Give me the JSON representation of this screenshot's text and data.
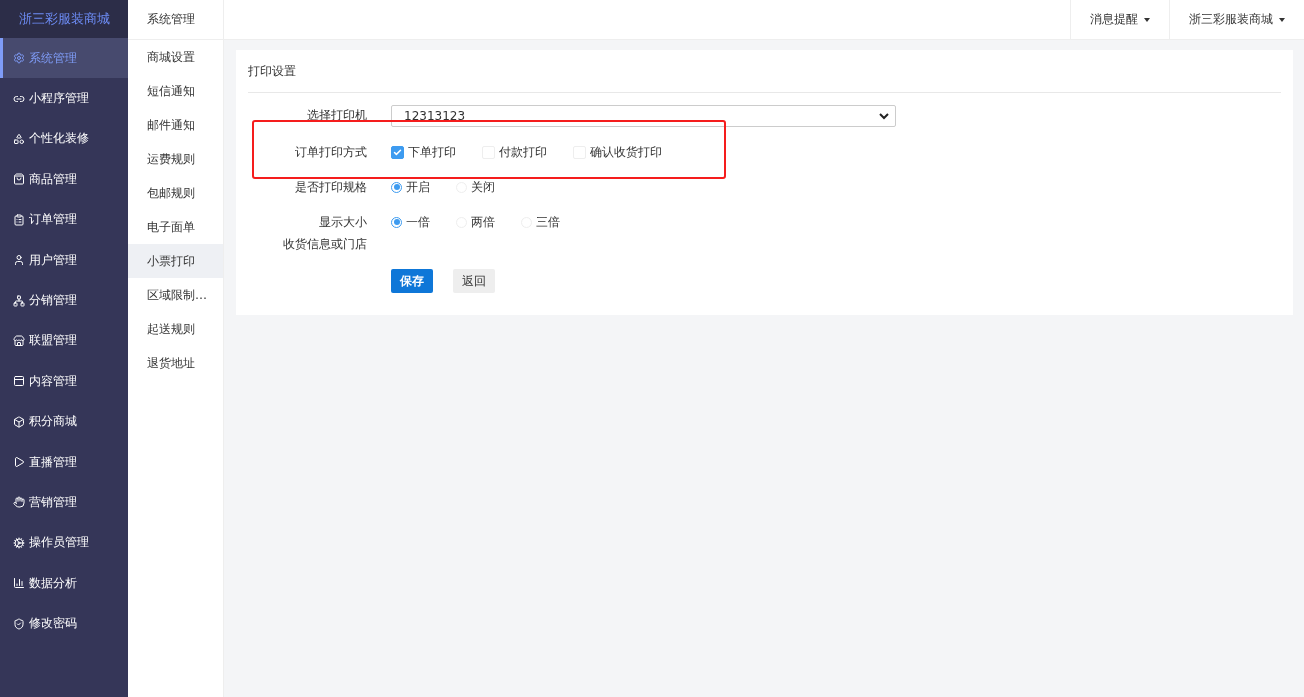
{
  "brand": "浙三彩服装商城",
  "sidebar": {
    "items": [
      {
        "label": "系统管理",
        "selected": true
      },
      {
        "label": "小程序管理",
        "selected": false
      },
      {
        "label": "个性化装修",
        "selected": false
      },
      {
        "label": "商品管理",
        "selected": false
      },
      {
        "label": "订单管理",
        "selected": false
      },
      {
        "label": "用户管理",
        "selected": false
      },
      {
        "label": "分销管理",
        "selected": false
      },
      {
        "label": "联盟管理",
        "selected": false
      },
      {
        "label": "内容管理",
        "selected": false
      },
      {
        "label": "积分商城",
        "selected": false
      },
      {
        "label": "直播管理",
        "selected": false
      },
      {
        "label": "营销管理",
        "selected": false
      },
      {
        "label": "操作员管理",
        "selected": false
      },
      {
        "label": "数据分析",
        "selected": false
      },
      {
        "label": "修改密码",
        "selected": false
      }
    ]
  },
  "submenu": {
    "title": "系统管理",
    "items": [
      {
        "label": "商城设置",
        "selected": false
      },
      {
        "label": "短信通知",
        "selected": false
      },
      {
        "label": "邮件通知",
        "selected": false
      },
      {
        "label": "运费规则",
        "selected": false
      },
      {
        "label": "包邮规则",
        "selected": false
      },
      {
        "label": "电子面单",
        "selected": false
      },
      {
        "label": "小票打印",
        "selected": true
      },
      {
        "label": "区域限制…",
        "selected": false
      },
      {
        "label": "起送规则",
        "selected": false
      },
      {
        "label": "退货地址",
        "selected": false
      }
    ]
  },
  "topbar": {
    "menus": [
      "消息提醒",
      "浙三彩服装商城"
    ]
  },
  "card": {
    "title": "打印设置",
    "highlight": true,
    "rows": [
      {
        "kind": "select",
        "label": "选择打印机",
        "value": "12313123"
      },
      {
        "kind": "checkbox",
        "label": "订单打印方式",
        "options": [
          {
            "label": "下单打印",
            "checked": true
          },
          {
            "label": "付款打印",
            "checked": false
          },
          {
            "label": "确认收货打印",
            "checked": false
          }
        ]
      },
      {
        "kind": "radio",
        "label": "是否打印规格",
        "options": [
          {
            "label": "开启",
            "selected": true
          },
          {
            "label": "关闭",
            "selected": false
          }
        ]
      },
      {
        "kind": "radio",
        "label": "显示大小",
        "sublabel": "收货信息或门店",
        "options": [
          {
            "label": "一倍",
            "selected": true
          },
          {
            "label": "两倍",
            "selected": false
          },
          {
            "label": "三倍",
            "selected": false
          }
        ]
      }
    ],
    "buttons": [
      {
        "label": "保存",
        "kind": "primary"
      },
      {
        "label": "返回",
        "kind": "default"
      }
    ]
  }
}
